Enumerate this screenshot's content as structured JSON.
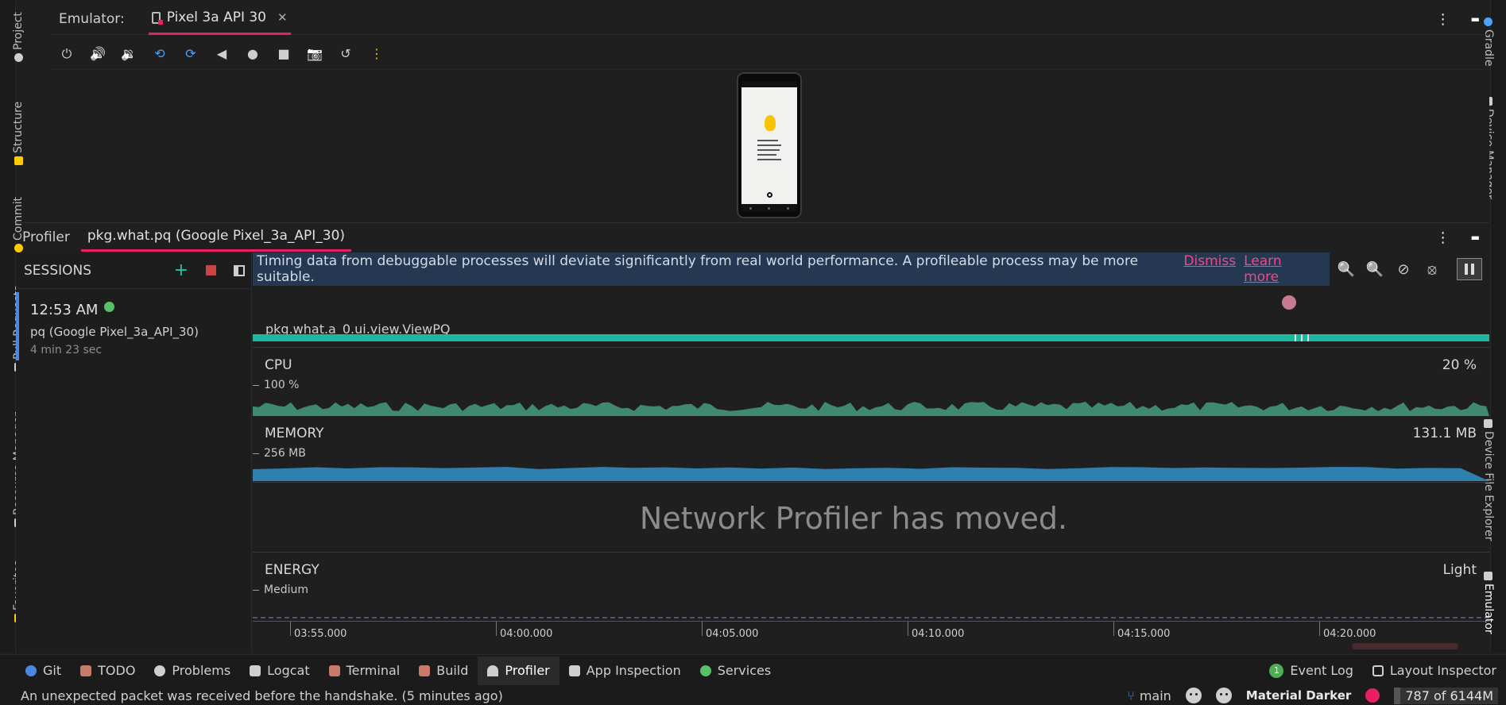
{
  "left_strip": {
    "tabs": [
      "Project",
      "Structure",
      "Commit",
      "Pull Requests",
      "Resource Manager",
      "Favorites"
    ]
  },
  "right_strip": {
    "tabs": [
      "Gradle",
      "Device Manager",
      "Device File Explorer",
      "Emulator"
    ]
  },
  "emulator": {
    "label": "Emulator:",
    "device_tab": "Pixel 3a API 30",
    "close_glyph": "✕",
    "menu_glyph": "⋮",
    "minimize_glyph": "▬",
    "toolbar_icons": [
      "power-icon",
      "volume-up-icon",
      "volume-down-icon",
      "rotate-left-icon",
      "rotate-right-icon",
      "back-icon",
      "home-icon",
      "overview-icon",
      "screenshot-icon",
      "snapshot-icon",
      "more-icon"
    ],
    "toolbar_glyphs": [
      "⏻",
      "🔊",
      "🔉",
      "⟲",
      "⟳",
      "◀",
      "●",
      "■",
      "📷",
      "↺",
      "⋮"
    ]
  },
  "profiler": {
    "tab_profiler": "Profiler",
    "tab_session": "pkg.what.pq (Google Pixel_3a_API_30)",
    "sessions_header": "SESSIONS",
    "add_glyph": "+",
    "session": {
      "time": "12:53 AM",
      "name": "pq (Google Pixel_3a_API_30)",
      "duration": "4 min 23 sec"
    },
    "banner": {
      "text": "Timing data from debuggable processes will deviate significantly from real world performance. A profileable process may be more suitable.",
      "dismiss": "Dismiss",
      "learn_more": "Learn more"
    },
    "zoom_glyphs": [
      "🔍",
      "🔍",
      "⊘",
      "⦻"
    ],
    "activity_label": "pkg.what.a_0.ui.view.ViewPQ",
    "cpu": {
      "title": "CPU",
      "value": "20 %",
      "scale": "100 %"
    },
    "memory": {
      "title": "MEMORY",
      "value": "131.1 MB",
      "scale": "256 MB"
    },
    "network_message": "Network Profiler has moved.",
    "energy": {
      "title": "ENERGY",
      "value": "Light",
      "scale": "Medium"
    },
    "timeline_ticks": [
      "03:55.000",
      "04:00.000",
      "04:05.000",
      "04:10.000",
      "04:15.000",
      "04:20.000"
    ]
  },
  "bottom_tabs": [
    {
      "label": "Git",
      "color": "#4a88e0"
    },
    {
      "label": "TODO",
      "color": "#c97a6a"
    },
    {
      "label": "Problems",
      "color": "#cfcfcf"
    },
    {
      "label": "Logcat",
      "color": "#cfcfcf"
    },
    {
      "label": "Terminal",
      "color": "#c97a6a"
    },
    {
      "label": "Build",
      "color": "#c97a6a"
    },
    {
      "label": "Profiler",
      "color": "#cfcfcf"
    },
    {
      "label": "App Inspection",
      "color": "#cfcfcf"
    },
    {
      "label": "Services",
      "color": "#59c06a"
    }
  ],
  "bottom_right": {
    "event_log_count": "1",
    "event_log": "Event Log",
    "layout_inspector": "Layout Inspector"
  },
  "status_bar": {
    "message": "An unexpected packet was received before the handshake. (5 minutes ago)",
    "branch": "main",
    "theme": "Material Darker",
    "memory": "787 of 6144M"
  },
  "colors": {
    "accent": "#e91e63",
    "cpu": "#3f8a6e",
    "memory": "#2f7fb0",
    "activity": "#1db89f",
    "banner": "#243852"
  }
}
